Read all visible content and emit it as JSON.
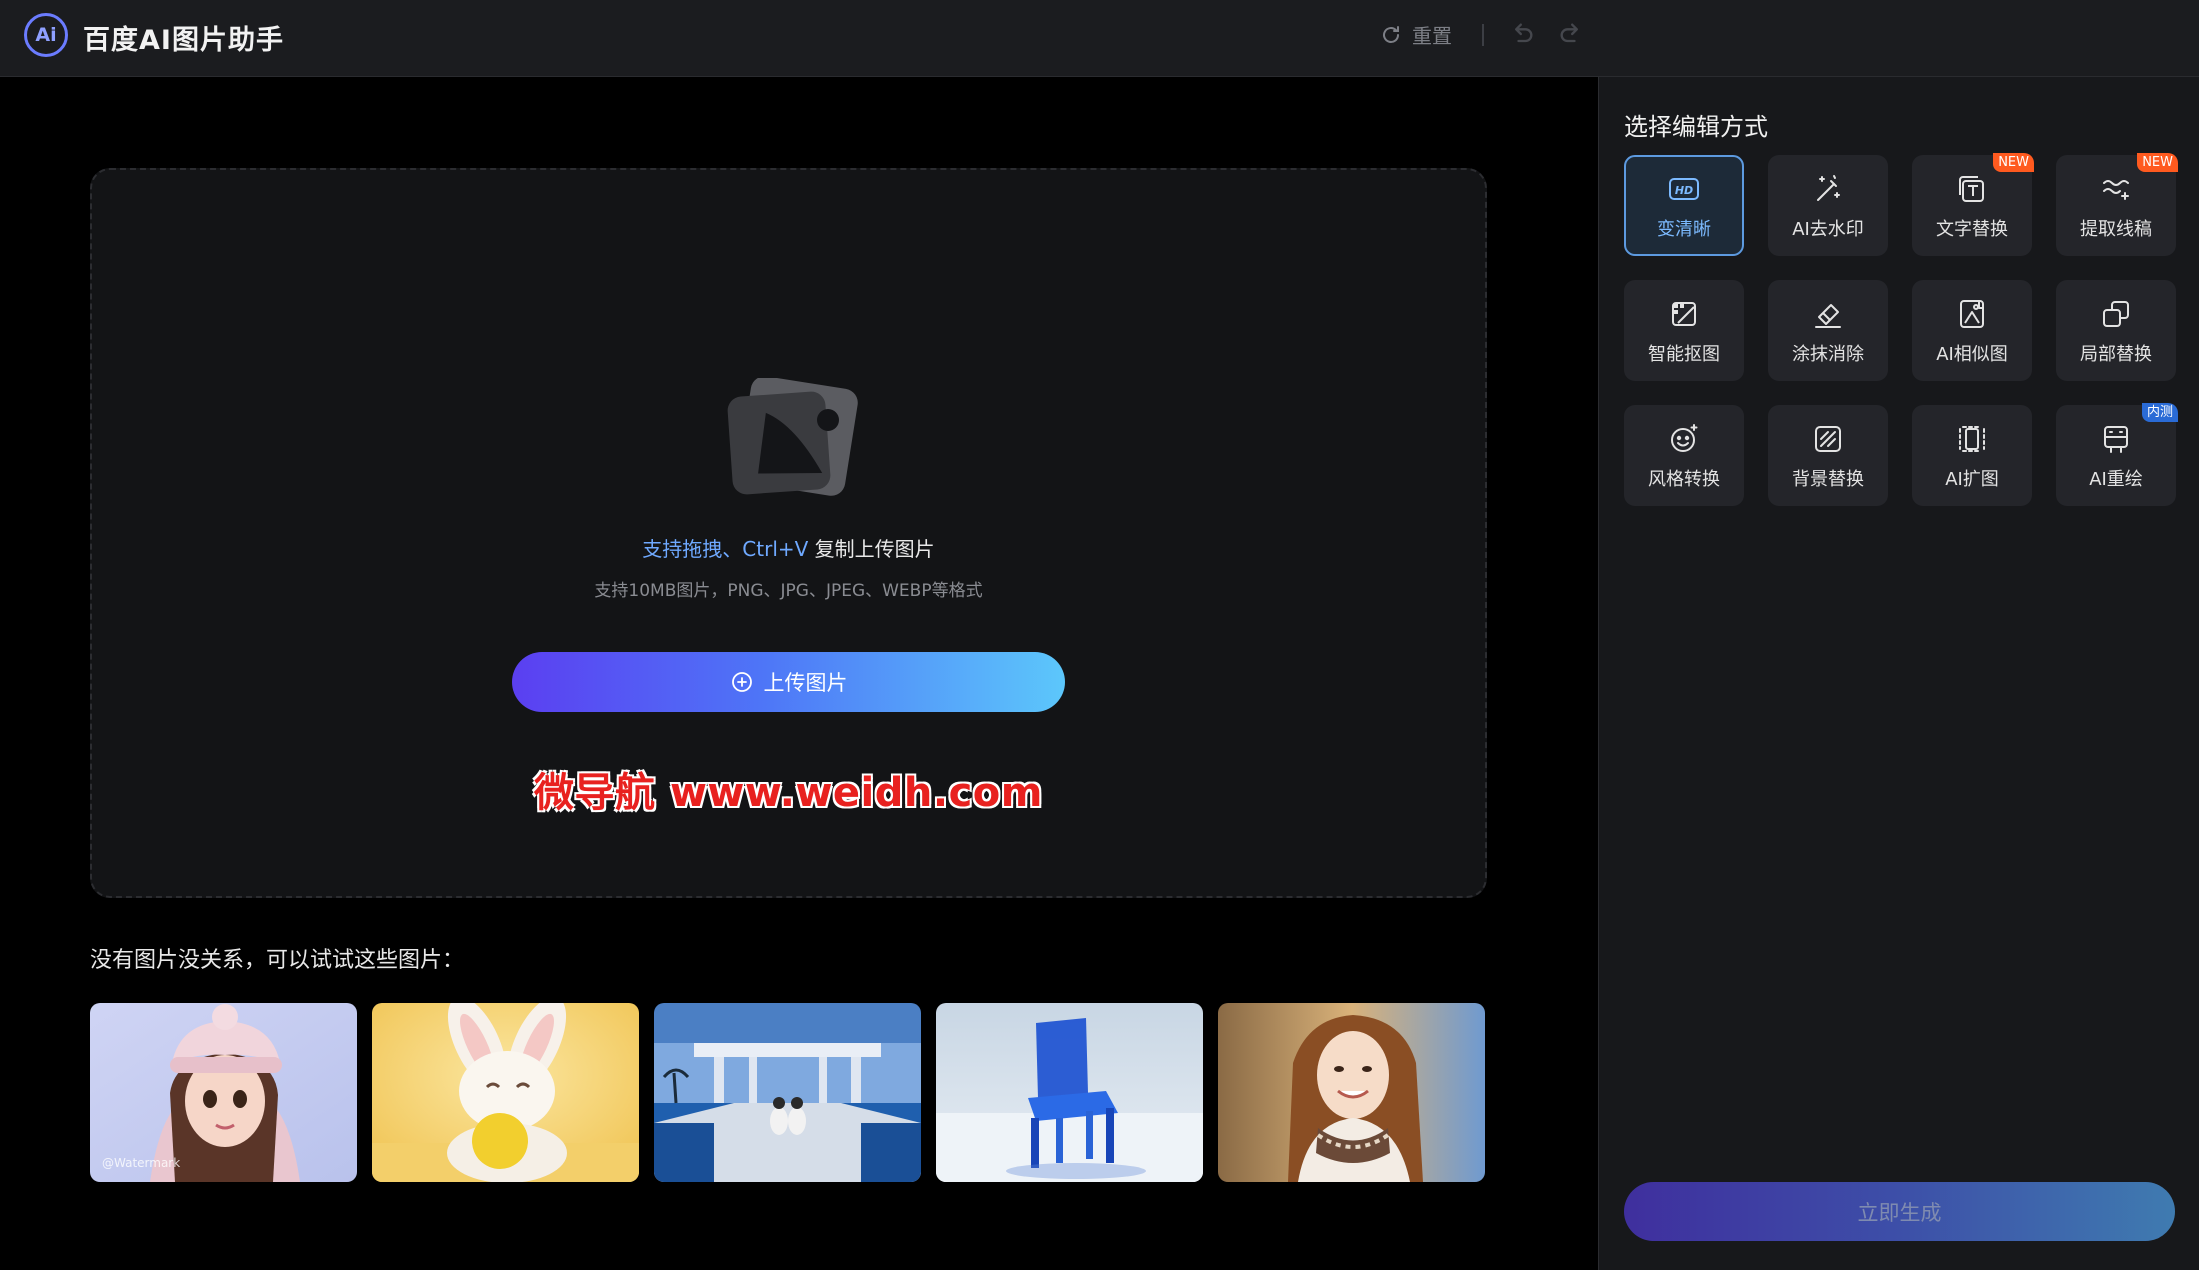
{
  "header": {
    "logo_text": "Ai",
    "app_title": "百度AI图片助手",
    "reset_label": "重置"
  },
  "upload": {
    "hint_link": "支持拖拽、Ctrl+V",
    "hint_rest": " 复制上传图片",
    "formats": "支持10MB图片，PNG、JPG、JPEG、WEBP等格式",
    "button_label": "上传图片"
  },
  "overlay_watermark": "微导航 www.weidh.com",
  "samples": {
    "heading": "没有图片没关系，可以试试这些图片：",
    "items": [
      {
        "name": "sample-girl-beanie",
        "watermark": "@Watermark"
      },
      {
        "name": "sample-bunny"
      },
      {
        "name": "sample-couple-pool"
      },
      {
        "name": "sample-blue-chair"
      },
      {
        "name": "sample-woman-scarf"
      }
    ]
  },
  "panel": {
    "title": "选择编辑方式",
    "tools": [
      {
        "label": "变清晰",
        "icon": "hd-icon",
        "active": true
      },
      {
        "label": "AI去水印",
        "icon": "magic-wand-icon"
      },
      {
        "label": "文字替换",
        "icon": "text-replace-icon",
        "badge": "NEW"
      },
      {
        "label": "提取线稿",
        "icon": "line-art-icon",
        "badge": "NEW"
      },
      {
        "label": "智能抠图",
        "icon": "cutout-icon"
      },
      {
        "label": "涂抹消除",
        "icon": "eraser-icon"
      },
      {
        "label": "AI相似图",
        "icon": "similar-image-icon"
      },
      {
        "label": "局部替换",
        "icon": "partial-replace-icon"
      },
      {
        "label": "风格转换",
        "icon": "style-face-icon"
      },
      {
        "label": "背景替换",
        "icon": "background-replace-icon"
      },
      {
        "label": "AI扩图",
        "icon": "expand-icon"
      },
      {
        "label": "AI重绘",
        "icon": "redraw-icon",
        "badge": "内测"
      }
    ],
    "generate_label": "立即生成"
  },
  "colors": {
    "accent_blue": "#6fa9ff",
    "badge_new": "#ff5a1f",
    "badge_beta": "#2a6bd6",
    "watermark_red": "#e8211f"
  }
}
